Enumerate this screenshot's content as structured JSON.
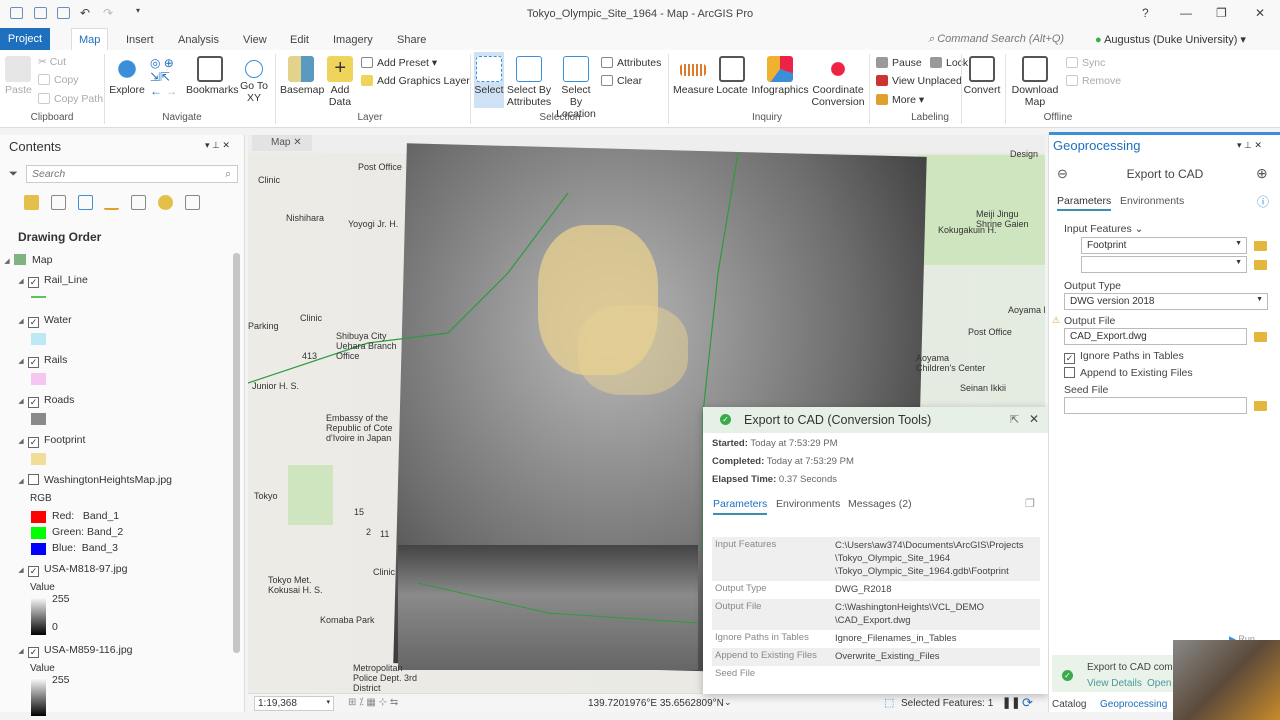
{
  "window": {
    "title": "Tokyo_Olympic_Site_1964 - Map - ArcGIS Pro",
    "help": "?",
    "command_search": "Command Search (Alt+Q)",
    "user": "Augustus (Duke University)"
  },
  "tabs": [
    "Project",
    "Map",
    "Insert",
    "Analysis",
    "View",
    "Edit",
    "Imagery",
    "Share"
  ],
  "ribbon": {
    "clipboard": {
      "label": "Clipboard",
      "paste": "Paste",
      "cut": "Cut",
      "copy": "Copy",
      "copy_path": "Copy Path"
    },
    "navigate": {
      "label": "Navigate",
      "explore": "Explore",
      "bookmarks": "Bookmarks",
      "goto": "Go To XY"
    },
    "layer": {
      "label": "Layer",
      "basemap": "Basemap",
      "add_data": "Add Data",
      "add_preset": "Add Preset",
      "add_graphics": "Add Graphics Layer"
    },
    "selection": {
      "label": "Selection",
      "select": "Select",
      "by_attr": "Select By Attributes",
      "by_loc": "Select By Location",
      "attributes": "Attributes",
      "clear": "Clear"
    },
    "inquiry": {
      "label": "Inquiry",
      "measure": "Measure",
      "locate": "Locate",
      "infographics": "Infographics",
      "coord": "Coordinate Conversion"
    },
    "labeling": {
      "label": "Labeling",
      "pause": "Pause",
      "lock": "Lock",
      "view_unplaced": "View Unplaced",
      "more": "More"
    },
    "convert": "Convert",
    "offline": {
      "label": "Offline",
      "download": "Download Map",
      "sync": "Sync",
      "remove": "Remove"
    }
  },
  "contents": {
    "title": "Contents",
    "search_placeholder": "Search",
    "drawing_order": "Drawing Order",
    "map": "Map",
    "layers": [
      {
        "name": "Rail_Line",
        "checked": true,
        "color": "#5cc35c"
      },
      {
        "name": "Water",
        "checked": true,
        "color": "#bfe8f5"
      },
      {
        "name": "Rails",
        "checked": true,
        "color": "#f5c6f2"
      },
      {
        "name": "Roads",
        "checked": true,
        "color": "#8a8a8a"
      },
      {
        "name": "Footprint",
        "checked": true,
        "color": "#f0dd9a"
      }
    ],
    "washington": {
      "name": "WashingtonHeightsMap.jpg",
      "checked": false,
      "rgb": "RGB",
      "bands": [
        {
          "label": "Red:   Band_1",
          "color": "#ff0000"
        },
        {
          "label": "Green: Band_2",
          "color": "#00ff00"
        },
        {
          "label": "Blue:  Band_3",
          "color": "#0000ff"
        }
      ]
    },
    "rasters": [
      {
        "name": "USA-M818-97.jpg",
        "checked": true,
        "value": "Value",
        "high": "255",
        "low": "0"
      },
      {
        "name": "USA-M859-116.jpg",
        "checked": true,
        "value": "Value",
        "high": "255"
      }
    ]
  },
  "map": {
    "tab": "Map",
    "labels": [
      "Post Office",
      "Clinic",
      "Nishihara",
      "Yoyogi Jr. H.",
      "Clinic",
      "Shibuya City Uehara Branch Office",
      "413",
      "Embassy of the Republic of Cote d'Ivoire in Japan",
      "Tokyo Met. Kokusai H. S.",
      "Clinic",
      "Komaba Park",
      "Metropolitan Police Dept. 3rd District",
      "Design",
      "Meiji Jingu Shrine Gaien",
      "Kokugakuin H.",
      "Post Office",
      "Aoyama Elem",
      "Aoyama Children's Center",
      "Seinan Ikkii",
      "Parking",
      "Junior H. S.",
      "Tokyo",
      "15",
      "2",
      "11"
    ],
    "scale": "1:19,368",
    "coords": "139.7201976°E 35.6562809°N",
    "selected": "Selected Features: 1"
  },
  "popup": {
    "title": "Export to CAD (Conversion Tools)",
    "started_label": "Started:",
    "started": "Today at 7:53:29 PM",
    "completed_label": "Completed:",
    "completed": "Today at 7:53:29 PM",
    "elapsed_label": "Elapsed Time:",
    "elapsed": "0.37 Seconds",
    "tabs": [
      "Parameters",
      "Environments",
      "Messages (2)"
    ],
    "params": [
      {
        "name": "Input Features",
        "value": "C:\\Users\\aw374\\Documents\\ArcGIS\\Projects\n\\Tokyo_Olympic_Site_1964\n\\Tokyo_Olympic_Site_1964.gdb\\Footprint"
      },
      {
        "name": "Output Type",
        "value": "DWG_R2018"
      },
      {
        "name": "Output File",
        "value": "C:\\WashingtonHeights\\VCL_DEMO\n\\CAD_Export.dwg"
      },
      {
        "name": "Ignore Paths in Tables",
        "value": "Ignore_Filenames_in_Tables"
      },
      {
        "name": "Append to Existing Files",
        "value": "Overwrite_Existing_Files"
      },
      {
        "name": "Seed File",
        "value": ""
      }
    ]
  },
  "geoprocessing": {
    "title": "Geoprocessing",
    "tool": "Export to CAD",
    "tabs": [
      "Parameters",
      "Environments"
    ],
    "input_features_label": "Input Features",
    "input_features": "Footprint",
    "input_features_2": "",
    "output_type_label": "Output Type",
    "output_type": "DWG version 2018",
    "output_file_label": "Output File",
    "output_file": "CAD_Export.dwg",
    "ignore_paths": {
      "label": "Ignore Paths in Tables",
      "checked": true
    },
    "append": {
      "label": "Append to Existing Files",
      "checked": false
    },
    "seed_file_label": "Seed File",
    "seed_file": "",
    "run": "Run",
    "toast": {
      "message": "Export to CAD com",
      "view_details": "View Details",
      "open": "Open"
    }
  },
  "bottom_tabs": [
    "Catalog",
    "Geoprocessing"
  ]
}
